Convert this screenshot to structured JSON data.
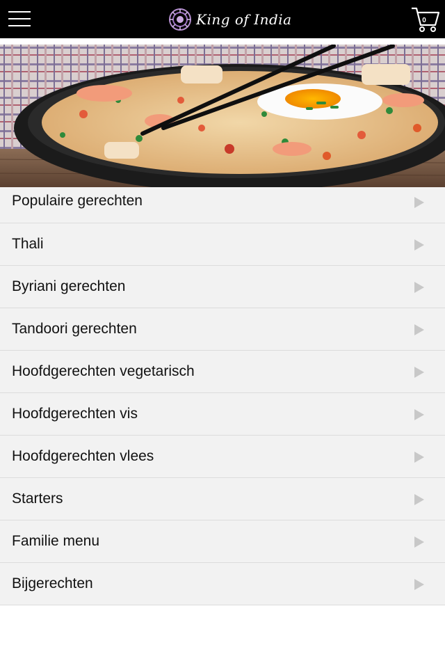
{
  "header": {
    "logo_text": "King of India",
    "cart_count": "0",
    "menu_icon": "hamburger-icon",
    "cart_icon": "shopping-cart-icon",
    "background": "#000000"
  },
  "hero": {
    "image": "fried-rice-with-shrimp-egg-and-chopsticks"
  },
  "categories": [
    {
      "label": "Populaire gerechten"
    },
    {
      "label": "Thali"
    },
    {
      "label": "Byriani gerechten"
    },
    {
      "label": "Tandoori gerechten"
    },
    {
      "label": "Hoofdgerechten vegetarisch"
    },
    {
      "label": "Hoofdgerechten vis"
    },
    {
      "label": "Hoofdgerechten vlees"
    },
    {
      "label": "Starters"
    },
    {
      "label": "Familie menu"
    },
    {
      "label": "Bijgerechten"
    }
  ],
  "colors": {
    "row_background": "#f2f2f2",
    "row_border": "#dcdcdc",
    "arrow": "#c8c8c8"
  }
}
